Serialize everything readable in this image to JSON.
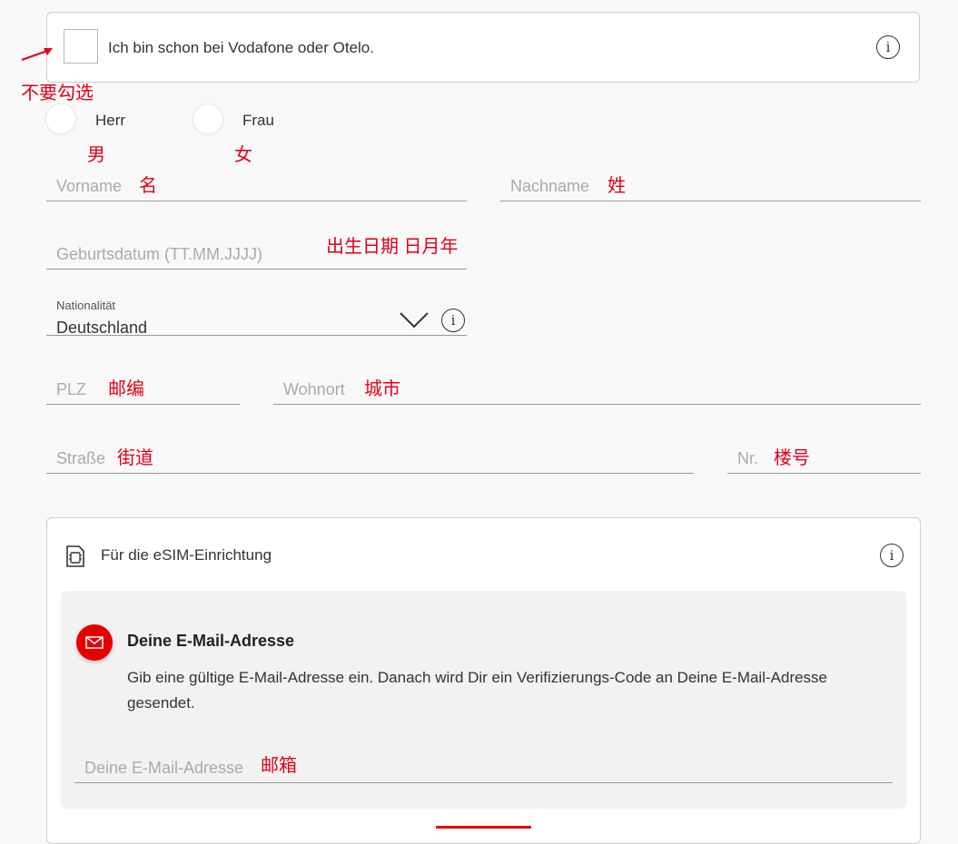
{
  "existing_customer": {
    "checkbox_label": "Ich bin schon bei Vodafone oder Otelo.",
    "note": "不要勾选"
  },
  "salutation": {
    "options": [
      {
        "label": "Herr",
        "note": "男"
      },
      {
        "label": "Frau",
        "note": "女"
      }
    ]
  },
  "fields": {
    "first_name": {
      "placeholder": "Vorname",
      "note": "名"
    },
    "last_name": {
      "placeholder": "Nachname",
      "note": "姓"
    },
    "birthdate": {
      "placeholder": "Geburtsdatum (TT.MM.JJJJ)",
      "note": "出生日期 日月年"
    },
    "zip": {
      "placeholder": "PLZ",
      "note": "邮编"
    },
    "city": {
      "placeholder": "Wohnort",
      "note": "城市"
    },
    "street": {
      "placeholder": "Straße",
      "note": "街道"
    },
    "house_number": {
      "placeholder": "Nr.",
      "note": "楼号"
    }
  },
  "nationality": {
    "label": "Nationalität",
    "value": "Deutschland"
  },
  "esim": {
    "title": "Für die eSIM-Einrichtung",
    "email_heading": "Deine E-Mail-Adresse",
    "email_description": "Gib eine gültige E-Mail-Adresse ein. Danach wird Dir ein Verifizierungs-Code an Deine E-Mail-Adresse gesendet.",
    "email_placeholder": "Deine E-Mail-Adresse",
    "email_note": "邮箱"
  },
  "icons": {
    "info": "info-icon",
    "chevron": "chevron-down-icon",
    "sim": "sim-card-icon",
    "mail": "mail-icon",
    "arrow": "arrow-annotation-icon"
  },
  "colors": {
    "accent": "#e60000",
    "annotation": "#e0001a"
  }
}
